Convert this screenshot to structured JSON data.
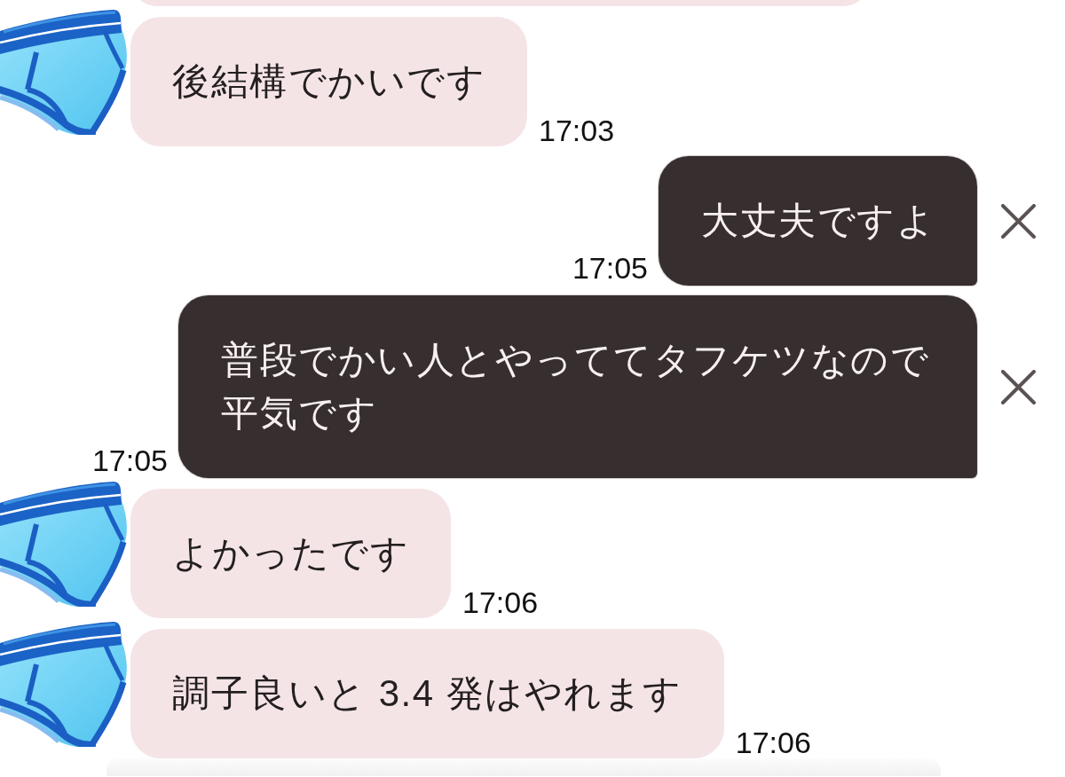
{
  "messages": [
    {
      "kind": "cut_off"
    },
    {
      "kind": "received",
      "text": "後結構でかいです",
      "time": "17:03"
    },
    {
      "kind": "sent",
      "text": "大丈夫ですよ",
      "time": "17:05",
      "close_button": true
    },
    {
      "kind": "sent",
      "text": "普段でかい人とやっててタフケツなので平気です",
      "time": "17:05",
      "close_button": true
    },
    {
      "kind": "received",
      "text": "よかったです",
      "time": "17:06"
    },
    {
      "kind": "received",
      "text": "調子良いと 3.4 発はやれます",
      "time": "17:06"
    }
  ]
}
